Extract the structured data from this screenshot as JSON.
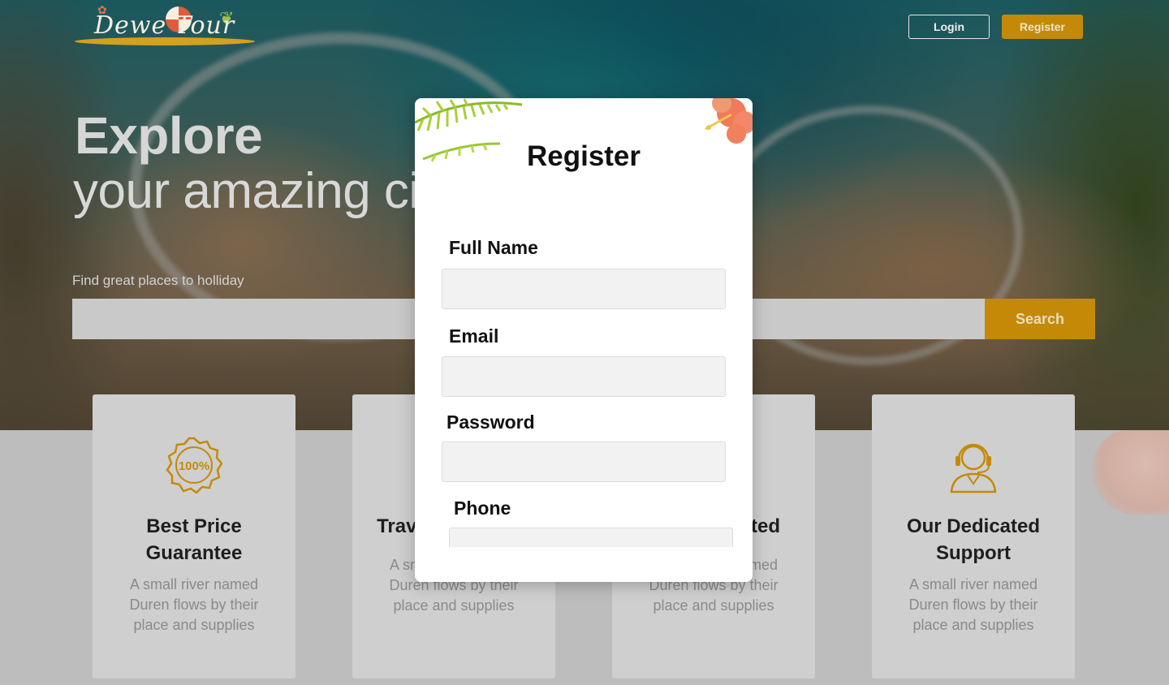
{
  "brand": {
    "logo_text": "Dewe Tour"
  },
  "header": {
    "login_label": "Login",
    "register_label": "Register"
  },
  "hero": {
    "title": "Explore",
    "subtitle": "your amazing city",
    "search_caption": "Find great places to holliday",
    "search_placeholder": "",
    "search_button": "Search"
  },
  "features": [
    {
      "title": "Best Price Guarantee",
      "desc": "A small river named Duren flows by their place and supplies",
      "icon": "100-percent-badge-icon"
    },
    {
      "title": "Travel Anywhere",
      "desc": "A small river named Duren flows by their place and supplies",
      "icon": "travel-icon"
    },
    {
      "title": "Our Dedicated Agent",
      "desc": "A small river named Duren flows by their place and supplies",
      "icon": "agent-icon"
    },
    {
      "title": "Our Dedicated Support",
      "desc": "A small river named Duren flows by their place and supplies",
      "icon": "headset-support-icon"
    }
  ],
  "modal": {
    "title": "Register",
    "fields": [
      {
        "label": "Full Name",
        "value": ""
      },
      {
        "label": "Email",
        "value": ""
      },
      {
        "label": "Password",
        "value": ""
      },
      {
        "label": "Phone",
        "value": ""
      }
    ]
  },
  "colors": {
    "accent": "#c48a07",
    "card_bg": "#cfcfcf"
  }
}
